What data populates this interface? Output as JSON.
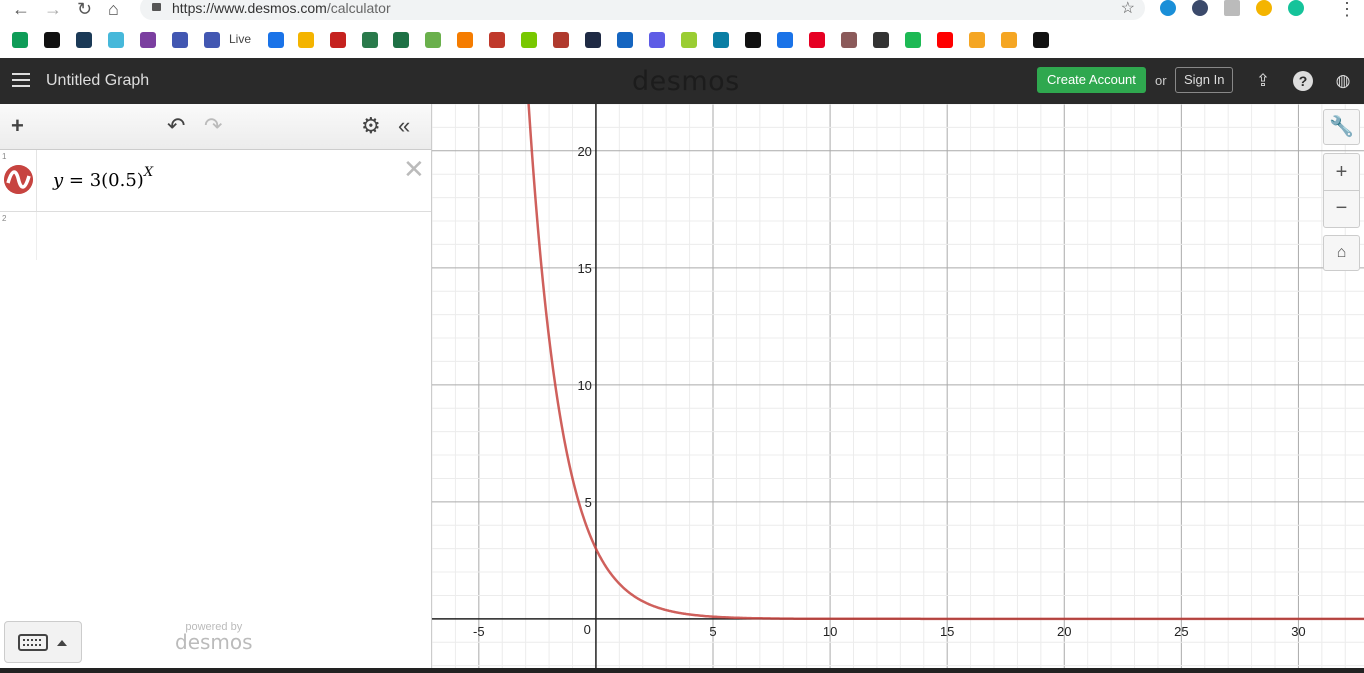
{
  "browser": {
    "url_host": "https://www.desmos.com",
    "url_path": "/calculator",
    "bookmarks": [
      "google-classroom",
      "schoology",
      "powerschool",
      "kahoot",
      "kahoot-2",
      "quizlet",
      "quizlet-live",
      "atlas",
      "google-drive",
      "gmail",
      "cpm",
      "cengage",
      "leaf",
      "khan-sun",
      "mcgraw-hill",
      "duolingo",
      "raptor",
      "pearson",
      "ixl",
      "grammarly",
      "maize",
      "p-app",
      "moon",
      "calendar",
      "pinterest",
      "avatar",
      "company",
      "spotify",
      "youtube",
      "s-app",
      "s-app-2",
      "book"
    ],
    "bookmark_label": "Live"
  },
  "header": {
    "title": "Untitled Graph",
    "logo": "desmos",
    "create_account": "Create Account",
    "or": "or",
    "sign_in": "Sign In"
  },
  "expressions": [
    {
      "index": "1",
      "lhs": "y",
      "text": " = 3(0.5)",
      "exponent": "X",
      "color": "#c74440"
    },
    {
      "index": "2"
    }
  ],
  "footer": {
    "powered_by": "powered by",
    "brand": "desmos"
  },
  "graph": {
    "function": "y = 3*(0.5)^x",
    "base": 3,
    "ratio": 0.5,
    "xrange": [
      -7,
      32.8
    ],
    "yrange": [
      -2.1,
      22
    ],
    "x_ticks": [
      "-5",
      "5",
      "10",
      "15",
      "20",
      "25",
      "30"
    ],
    "x_tick_values": [
      -5,
      5,
      10,
      15,
      20,
      25,
      30
    ],
    "y_ticks": [
      "5",
      "10",
      "15",
      "20"
    ],
    "y_tick_values": [
      5,
      10,
      15,
      20
    ],
    "origin_label": "0",
    "curve_color": "#c74440"
  }
}
